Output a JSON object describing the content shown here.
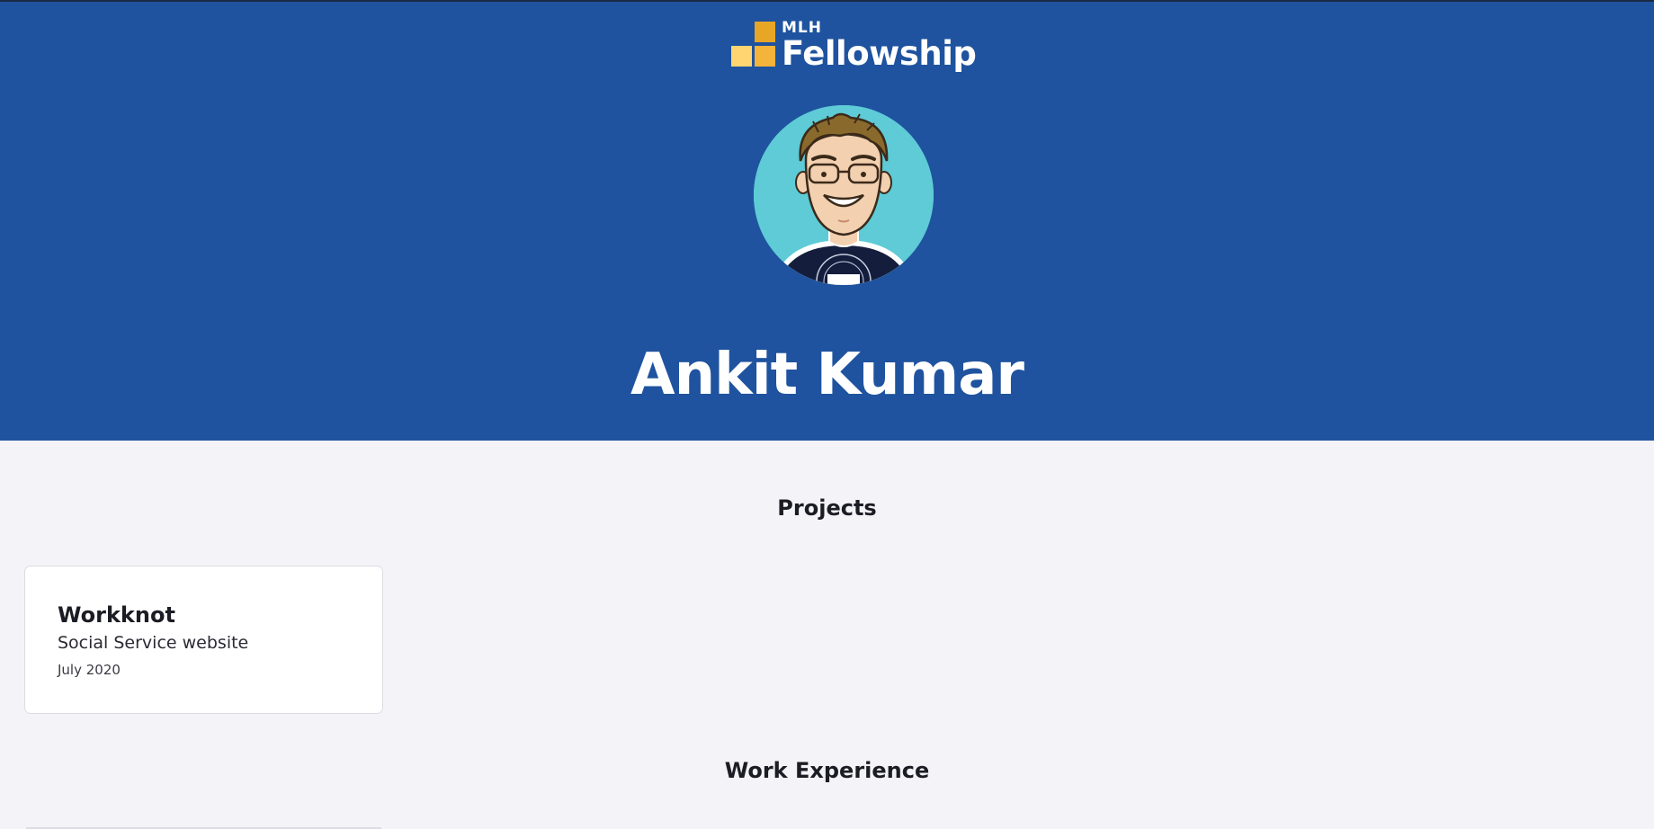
{
  "brand": {
    "small": "MLH",
    "name": "Fellowship",
    "colors": {
      "primary": "#1f539f",
      "accent": "#e7a626",
      "accent_light": "#ffd571"
    }
  },
  "profile": {
    "name": "Ankit Kumar",
    "avatar_icon": "mlh-mascot-avatar"
  },
  "sections": {
    "projects": {
      "title": "Projects",
      "items": [
        {
          "title": "Workknot",
          "description": "Social Service website",
          "date": "July 2020"
        }
      ]
    },
    "work": {
      "title": "Work Experience"
    }
  }
}
